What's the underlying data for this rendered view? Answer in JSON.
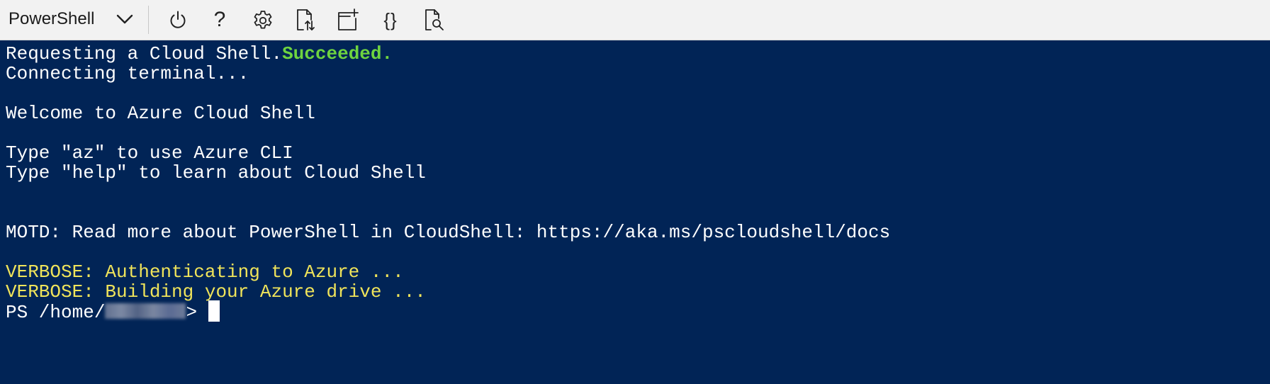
{
  "toolbar": {
    "shell_label": "PowerShell",
    "chevron_icon": "chevron-down-icon",
    "buttons": [
      {
        "name": "restart",
        "icon": "power-icon"
      },
      {
        "name": "help",
        "icon": "help-icon",
        "glyph": "?"
      },
      {
        "name": "settings",
        "icon": "gear-icon"
      },
      {
        "name": "upload-download",
        "icon": "upload-download-files-icon"
      },
      {
        "name": "new-session",
        "icon": "new-session-icon"
      },
      {
        "name": "editor",
        "icon": "braces-icon",
        "glyph": "{}"
      },
      {
        "name": "web-preview",
        "icon": "web-preview-icon"
      }
    ]
  },
  "terminal": {
    "line1_prefix": "Requesting a Cloud Shell.",
    "line1_status": "Succeeded.",
    "line2": "Connecting terminal...",
    "line4": "Welcome to Azure Cloud Shell",
    "line6": "Type \"az\" to use Azure CLI",
    "line7": "Type \"help\" to learn about Cloud Shell",
    "line10": "MOTD: Read more about PowerShell in CloudShell: https://aka.ms/pscloudshell/docs",
    "line12": "VERBOSE: Authenticating to Azure ...",
    "line13": "VERBOSE: Building your Azure drive ...",
    "prompt_prefix": "PS /home/",
    "prompt_suffix": "> "
  },
  "colors": {
    "terminal_bg": "#012456",
    "success_green": "#6ed43f",
    "verbose_yellow": "#f0e45a",
    "text": "#ffffff",
    "toolbar_bg": "#f2f2f2"
  }
}
